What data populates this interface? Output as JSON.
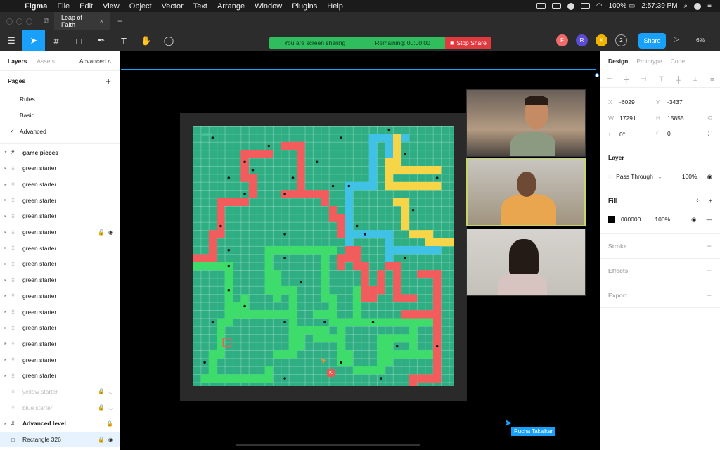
{
  "menubar": {
    "app_name": "Figma",
    "menus": [
      "File",
      "Edit",
      "View",
      "Object",
      "Vector",
      "Text",
      "Arrange",
      "Window",
      "Plugins",
      "Help"
    ],
    "battery": "100%",
    "clock": "2:57:39 PM"
  },
  "tabbar": {
    "doc_title": "Leap of Faith"
  },
  "share_banner": {
    "sharing_text": "You are screen sharing",
    "remaining_text": "Remaining: 00:00:00",
    "stop_label": "Stop Share"
  },
  "collaborators": [
    {
      "initial": "F",
      "color": "#f06a6a"
    },
    {
      "initial": "R",
      "color": "#5c4bd6"
    },
    {
      "initial": "K",
      "color": "#f0b400"
    }
  ],
  "collab_count": "2",
  "toolbar": {
    "share_label": "Share",
    "zoom": "6%"
  },
  "left_panel": {
    "tabs": {
      "layers": "Layers",
      "assets": "Assets",
      "advanced": "Advanced"
    },
    "pages_title": "Pages",
    "pages": [
      "Rules",
      "Basic",
      "Advanced"
    ],
    "active_page": "Advanced",
    "group_name": "game pieces",
    "layers": [
      "green starter",
      "green starter",
      "green starter",
      "green starter",
      "green starter",
      "green starter",
      "green starter",
      "green starter",
      "green starter",
      "green starter",
      "green starter",
      "green starter",
      "green starter",
      "green starter"
    ],
    "dim_layers": [
      "yellow starter",
      "blue starter"
    ],
    "frame_layer": "Advanced level",
    "selected_layer": "Rectangle 326"
  },
  "right_panel": {
    "tabs": {
      "design": "Design",
      "prototype": "Prototype",
      "code": "Code"
    },
    "x": "-6029",
    "y": "-3437",
    "w": "17291",
    "h": "15855",
    "rotation": "0°",
    "radius": "0",
    "layer_title": "Layer",
    "blend_mode": "Pass Through",
    "layer_opacity": "100%",
    "fill_title": "Fill",
    "fill_hex": "000000",
    "fill_opacity": "100%",
    "stroke_title": "Stroke",
    "effects_title": "Effects",
    "export_title": "Export"
  },
  "canvas": {
    "board_label": "onex",
    "cursor_initial": "K",
    "remote_cursor_name": "Rucha Takalkar",
    "board_colors": {
      "green": "#2fae84",
      "red": "#f25c5c",
      "lightgreen": "#3ddc6b",
      "blue": "#3fc2e6",
      "yellow": "#f7d548"
    }
  }
}
